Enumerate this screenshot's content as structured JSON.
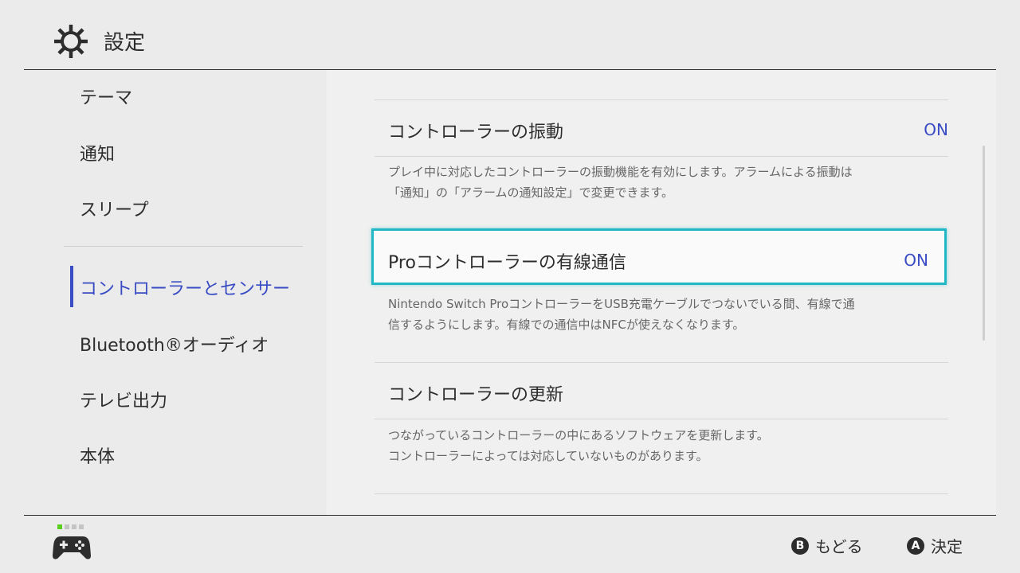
{
  "header": {
    "title": "設定",
    "icon": "gear-icon"
  },
  "sidebar": {
    "items": [
      {
        "label": "テーマ"
      },
      {
        "label": "通知"
      },
      {
        "label": "スリープ"
      },
      {
        "label": "コントローラーとセンサー",
        "active": true
      },
      {
        "label": "Bluetooth®オーディオ"
      },
      {
        "label": "テレビ出力"
      },
      {
        "label": "本体"
      }
    ]
  },
  "settings": [
    {
      "label": "コントローラーの振動",
      "value": "ON",
      "description_lines": [
        "プレイ中に対応したコントローラーの振動機能を有効にします。アラームによる振動は",
        "「通知」の「アラームの通知設定」で変更できます。"
      ]
    },
    {
      "label": "Proコントローラーの有線通信",
      "value": "ON",
      "selected": true,
      "description_lines": [
        "Nintendo Switch ProコントローラーをUSB充電ケーブルでつないでいる間、有線で通",
        "信するようにします。有線での通信中はNFCが使えなくなります。"
      ]
    },
    {
      "label": "コントローラーの更新",
      "description_lines": [
        "つながっているコントローラーの中にあるソフトウェアを更新します。",
        "コントローラーによっては対応していないものがあります。"
      ]
    }
  ],
  "footer": {
    "controller_icon": "gamepad-icon",
    "back": {
      "button": "B",
      "label": "もどる"
    },
    "confirm": {
      "button": "A",
      "label": "決定"
    }
  },
  "colors": {
    "accent": "#3a4cc4",
    "selection": "#21b7c4",
    "indicator": "#5ad01e"
  }
}
